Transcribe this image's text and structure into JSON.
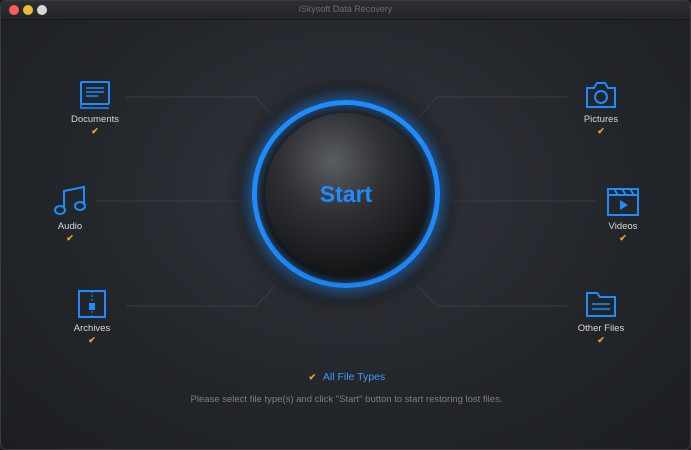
{
  "window": {
    "title": "iSkysoft Data Recovery"
  },
  "file_types": [
    {
      "label": "Documents",
      "icon": "document-icon",
      "checked": true
    },
    {
      "label": "Audio",
      "icon": "music-note-icon",
      "checked": true
    },
    {
      "label": "Archives",
      "icon": "archive-icon",
      "checked": true
    },
    {
      "label": "Pictures",
      "icon": "camera-icon",
      "checked": true
    },
    {
      "label": "Videos",
      "icon": "clapperboard-icon",
      "checked": true
    },
    {
      "label": "Other Files",
      "icon": "folder-icon",
      "checked": true
    }
  ],
  "start_button": {
    "label": "Start"
  },
  "all_file_types": {
    "label": "All File Types",
    "checked": true
  },
  "hint": "Please select file type(s) and click \"Start\" button to start restoring lost files.",
  "colors": {
    "accent": "#1e8cff",
    "check": "#f0a020",
    "label": "#d5d8dc"
  }
}
